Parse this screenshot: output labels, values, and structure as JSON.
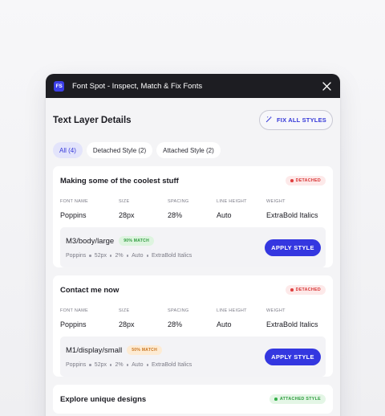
{
  "window": {
    "app_icon_text": "FS",
    "title": "Font Spot - Inspect, Match & Fix Fonts"
  },
  "header": {
    "title": "Text Layer Details",
    "fix_all_label": "FIX ALL STYLES"
  },
  "tabs": [
    {
      "label": "All (4)",
      "active": true
    },
    {
      "label": "Detached Style (2)",
      "active": false
    },
    {
      "label": "Attached Style (2)",
      "active": false
    }
  ],
  "prop_labels": {
    "font_name": "FONT NAME",
    "size": "SIZE",
    "spacing": "SPACING",
    "line_height": "LINE HEIGHT",
    "weight": "WEIGHT"
  },
  "layers": [
    {
      "name": "Making some of the coolest stuff",
      "status": "DETACHED",
      "font_name": "Poppins",
      "size": "28px",
      "spacing": "28%",
      "line_height": "Auto",
      "weight": "ExtraBold Italics",
      "match": {
        "style_name": "M3/body/large",
        "match_label": "90% MATCH",
        "meta": [
          "Poppins",
          "52px",
          "2%",
          "Auto",
          "ExtraBold Italics"
        ],
        "apply_label": "APPLY STYLE"
      }
    },
    {
      "name": "Contact me now",
      "status": "DETACHED",
      "font_name": "Poppins",
      "size": "28px",
      "spacing": "28%",
      "line_height": "Auto",
      "weight": "ExtraBold Italics",
      "match": {
        "style_name": "M1/display/small",
        "match_label": "50% MATCH",
        "meta": [
          "Poppins",
          "52px",
          "2%",
          "Auto",
          "ExtraBold Italics"
        ],
        "apply_label": "APPLY STYLE"
      }
    },
    {
      "name": "Explore unique designs",
      "status": "ATTACHED STYLE"
    }
  ],
  "colors": {
    "accent": "#3437e0",
    "titlebar": "#1d1d22",
    "detached": "#d83434",
    "attached": "#2c9c3c"
  }
}
